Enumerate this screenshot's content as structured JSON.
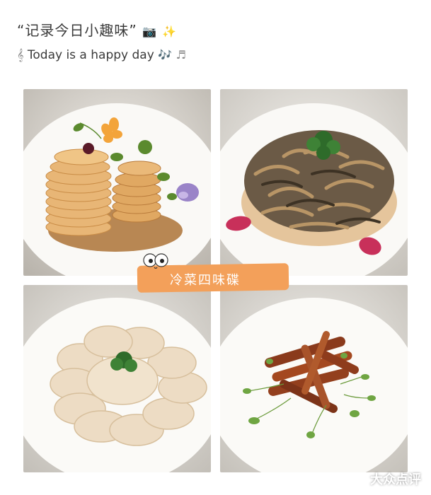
{
  "header": {
    "title": "“记录今日小趣味”",
    "title_icons": [
      "📷",
      "✨"
    ],
    "subtitle": "Today is a happy day",
    "subtitle_prefix_icon": "𝄞",
    "subtitle_suffix_icons": [
      "🎶",
      "♬"
    ]
  },
  "banner": {
    "text": "冷菜四味碟"
  },
  "watermark": {
    "text": "大众点评"
  },
  "photos": [
    {
      "dish": "potato-stack-dish"
    },
    {
      "dish": "mushroom-mound-dish"
    },
    {
      "dish": "sliced-root-dish"
    },
    {
      "dish": "braised-strips-dish"
    }
  ],
  "colors": {
    "banner": "#f3a05a",
    "text": "#3a3a3a"
  }
}
